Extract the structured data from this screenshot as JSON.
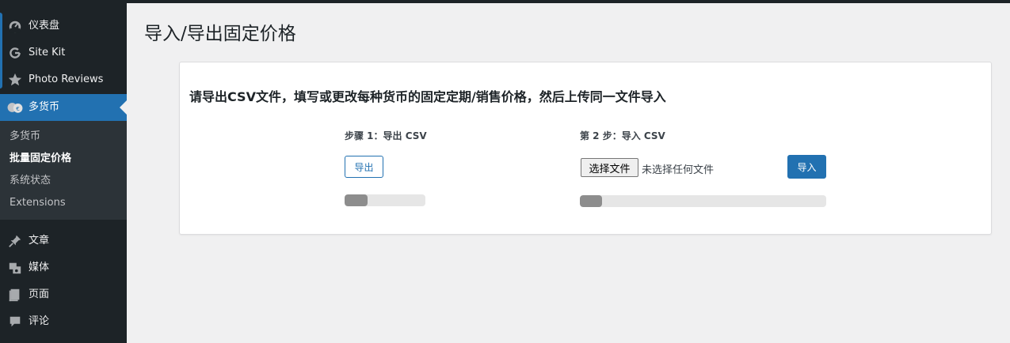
{
  "sidebar": {
    "items": [
      {
        "label": "仪表盘",
        "icon": "dashboard-icon"
      },
      {
        "label": "Site Kit",
        "icon": "google-g-icon"
      },
      {
        "label": "Photo Reviews",
        "icon": "star-icon"
      },
      {
        "label": "多货币",
        "icon": "currency-icon",
        "active": true
      },
      {
        "label": "文章",
        "icon": "pin-icon"
      },
      {
        "label": "媒体",
        "icon": "media-icon"
      },
      {
        "label": "页面",
        "icon": "pages-icon"
      },
      {
        "label": "评论",
        "icon": "comment-icon"
      }
    ],
    "submenu": [
      "多货币",
      "批量固定价格",
      "系统状态",
      "Extensions"
    ],
    "submenu_current": "批量固定价格"
  },
  "page": {
    "title": "导入/导出固定价格",
    "heading": "请导出CSV文件，填写或更改每种货币的固定定期/销售价格，然后上传同一文件导入"
  },
  "export": {
    "step_label": "步骤 1：导出 CSV",
    "button_label": "导出",
    "progress": 0.28
  },
  "import": {
    "step_label": "第 2 步：导入 CSV",
    "file_button_label": "选择文件",
    "file_status": "未选择任何文件",
    "button_label": "导入",
    "progress": 0.09
  },
  "colors": {
    "sidebar_bg": "#1d2327",
    "accent": "#2271b1",
    "progress_fill": "#8d8d8d"
  }
}
